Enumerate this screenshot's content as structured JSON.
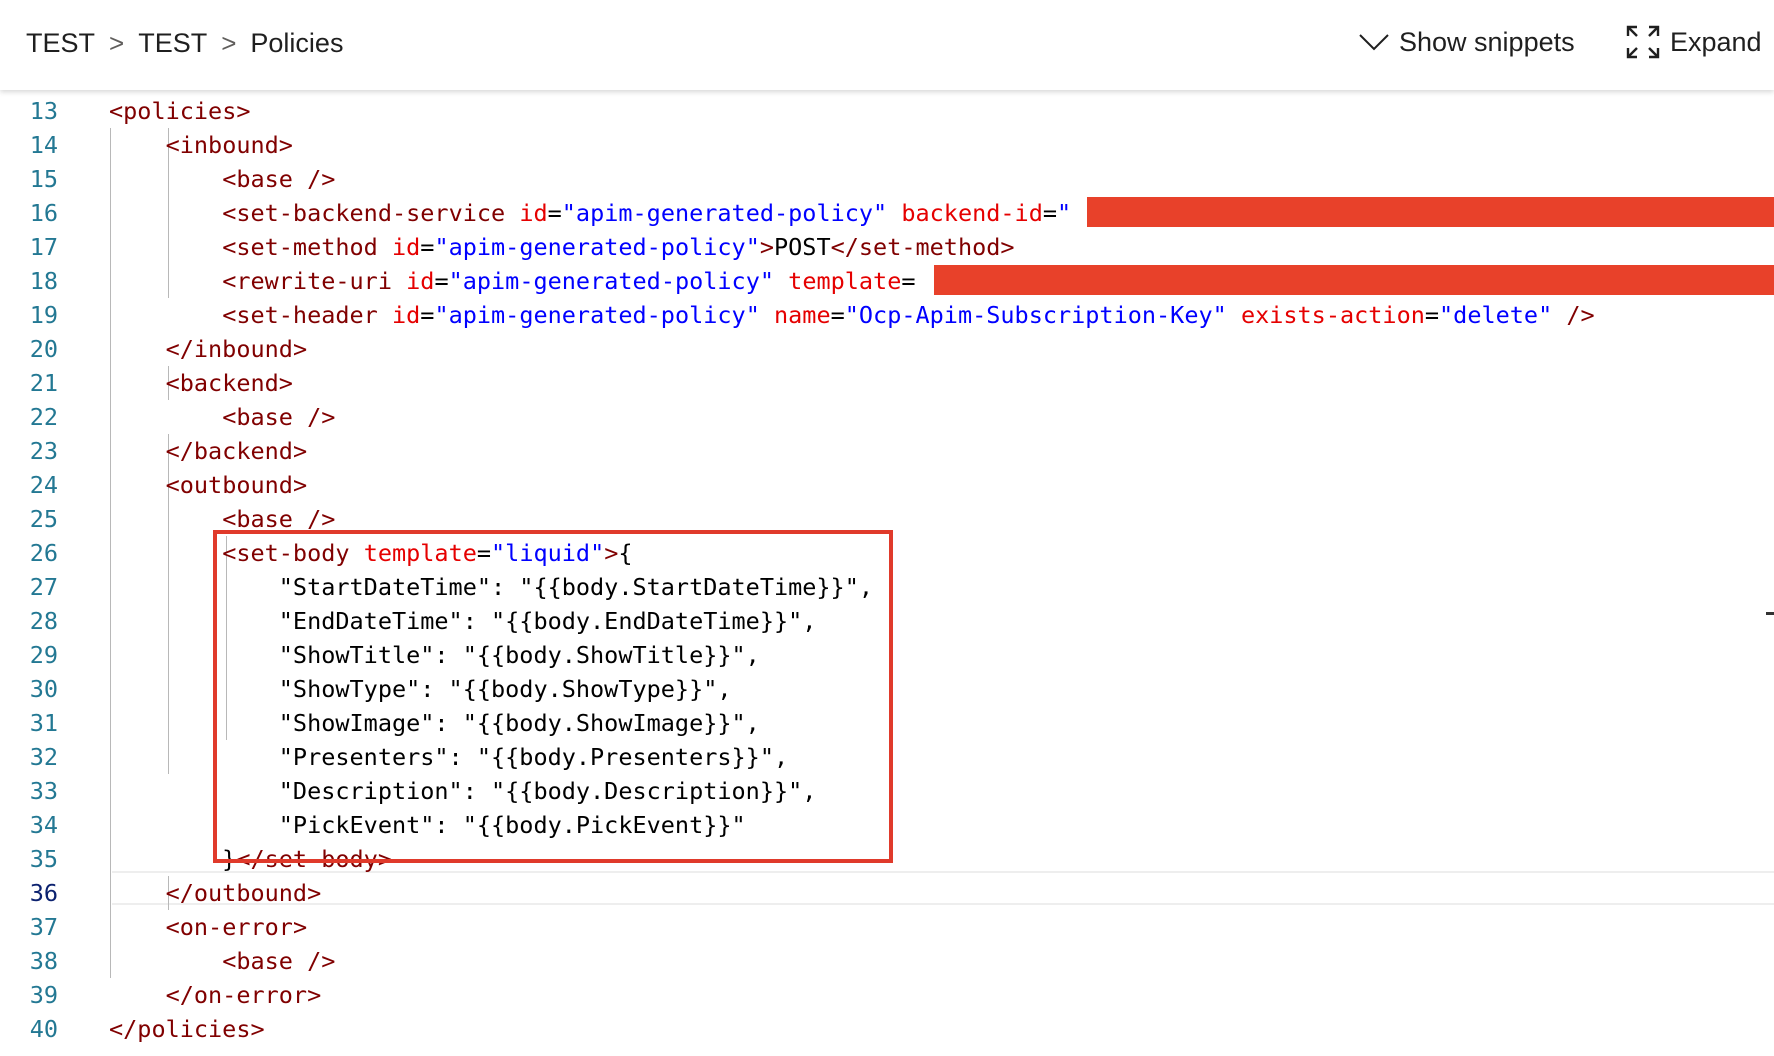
{
  "header": {
    "breadcrumb": [
      "TEST",
      "TEST",
      "Policies"
    ],
    "breadcrumb_separator": ">",
    "show_snippets_label": "Show snippets",
    "expand_label": "Expand"
  },
  "icons": {
    "show_snippets": "chevron-down-icon",
    "expand": "expand-arrows-icon"
  },
  "colors": {
    "tag": "#800000",
    "attribute_name": "#e50000",
    "attribute_value": "#0000ff",
    "line_number": "#237893",
    "redaction": "#e8412a",
    "highlight_box": "#e03a2b"
  },
  "editor": {
    "active_line": 36,
    "lines": [
      {
        "n": "13",
        "tokens": [
          [
            "dl",
            "<"
          ],
          [
            "tg",
            "policies"
          ],
          [
            "dl",
            ">"
          ]
        ]
      },
      {
        "n": "14",
        "tokens": [
          [
            "tx",
            "    "
          ],
          [
            "dl",
            "<"
          ],
          [
            "tg",
            "inbound"
          ],
          [
            "dl",
            ">"
          ]
        ]
      },
      {
        "n": "15",
        "tokens": [
          [
            "tx",
            "        "
          ],
          [
            "dl",
            "<"
          ],
          [
            "tg",
            "base"
          ],
          [
            "tx",
            " "
          ],
          [
            "dl",
            "/>"
          ]
        ]
      },
      {
        "n": "16",
        "tokens": [
          [
            "tx",
            "        "
          ],
          [
            "dl",
            "<"
          ],
          [
            "tg",
            "set-backend-service"
          ],
          [
            "tx",
            " "
          ],
          [
            "at",
            "id"
          ],
          [
            "eq",
            "="
          ],
          [
            "av",
            "\"apim-generated-policy\""
          ],
          [
            "tx",
            " "
          ],
          [
            "at",
            "backend-id"
          ],
          [
            "eq",
            "="
          ],
          [
            "av",
            "\""
          ]
        ]
      },
      {
        "n": "17",
        "tokens": [
          [
            "tx",
            "        "
          ],
          [
            "dl",
            "<"
          ],
          [
            "tg",
            "set-method"
          ],
          [
            "tx",
            " "
          ],
          [
            "at",
            "id"
          ],
          [
            "eq",
            "="
          ],
          [
            "av",
            "\"apim-generated-policy\""
          ],
          [
            "dl",
            ">"
          ],
          [
            "tx",
            "POST"
          ],
          [
            "dl",
            "</"
          ],
          [
            "tg",
            "set-method"
          ],
          [
            "dl",
            ">"
          ]
        ]
      },
      {
        "n": "18",
        "tokens": [
          [
            "tx",
            "        "
          ],
          [
            "dl",
            "<"
          ],
          [
            "tg",
            "rewrite-uri"
          ],
          [
            "tx",
            " "
          ],
          [
            "at",
            "id"
          ],
          [
            "eq",
            "="
          ],
          [
            "av",
            "\"apim-generated-policy\""
          ],
          [
            "tx",
            " "
          ],
          [
            "at",
            "template"
          ],
          [
            "eq",
            "="
          ]
        ]
      },
      {
        "n": "19",
        "tokens": [
          [
            "tx",
            "        "
          ],
          [
            "dl",
            "<"
          ],
          [
            "tg",
            "set-header"
          ],
          [
            "tx",
            " "
          ],
          [
            "at",
            "id"
          ],
          [
            "eq",
            "="
          ],
          [
            "av",
            "\"apim-generated-policy\""
          ],
          [
            "tx",
            " "
          ],
          [
            "at",
            "name"
          ],
          [
            "eq",
            "="
          ],
          [
            "av",
            "\"Ocp-Apim-Subscription-Key\""
          ],
          [
            "tx",
            " "
          ],
          [
            "at",
            "exists-action"
          ],
          [
            "eq",
            "="
          ],
          [
            "av",
            "\"delete\""
          ],
          [
            "tx",
            " "
          ],
          [
            "dl",
            "/>"
          ]
        ]
      },
      {
        "n": "20",
        "tokens": [
          [
            "tx",
            "    "
          ],
          [
            "dl",
            "</"
          ],
          [
            "tg",
            "inbound"
          ],
          [
            "dl",
            ">"
          ]
        ]
      },
      {
        "n": "21",
        "tokens": [
          [
            "tx",
            "    "
          ],
          [
            "dl",
            "<"
          ],
          [
            "tg",
            "backend"
          ],
          [
            "dl",
            ">"
          ]
        ]
      },
      {
        "n": "22",
        "tokens": [
          [
            "tx",
            "        "
          ],
          [
            "dl",
            "<"
          ],
          [
            "tg",
            "base"
          ],
          [
            "tx",
            " "
          ],
          [
            "dl",
            "/>"
          ]
        ]
      },
      {
        "n": "23",
        "tokens": [
          [
            "tx",
            "    "
          ],
          [
            "dl",
            "</"
          ],
          [
            "tg",
            "backend"
          ],
          [
            "dl",
            ">"
          ]
        ]
      },
      {
        "n": "24",
        "tokens": [
          [
            "tx",
            "    "
          ],
          [
            "dl",
            "<"
          ],
          [
            "tg",
            "outbound"
          ],
          [
            "dl",
            ">"
          ]
        ]
      },
      {
        "n": "25",
        "tokens": [
          [
            "tx",
            "        "
          ],
          [
            "dl",
            "<"
          ],
          [
            "tg",
            "base"
          ],
          [
            "tx",
            " "
          ],
          [
            "dl",
            "/>"
          ]
        ]
      },
      {
        "n": "26",
        "tokens": [
          [
            "tx",
            "        "
          ],
          [
            "dl",
            "<"
          ],
          [
            "tg",
            "set-body"
          ],
          [
            "tx",
            " "
          ],
          [
            "at",
            "template"
          ],
          [
            "eq",
            "="
          ],
          [
            "av",
            "\"liquid\""
          ],
          [
            "dl",
            ">"
          ],
          [
            "tx",
            "{"
          ]
        ]
      },
      {
        "n": "27",
        "tokens": [
          [
            "tx",
            "            \"StartDateTime\": \"{{body.StartDateTime}}\","
          ]
        ]
      },
      {
        "n": "28",
        "tokens": [
          [
            "tx",
            "            \"EndDateTime\": \"{{body.EndDateTime}}\","
          ]
        ]
      },
      {
        "n": "29",
        "tokens": [
          [
            "tx",
            "            \"ShowTitle\": \"{{body.ShowTitle}}\","
          ]
        ]
      },
      {
        "n": "30",
        "tokens": [
          [
            "tx",
            "            \"ShowType\": \"{{body.ShowType}}\","
          ]
        ]
      },
      {
        "n": "31",
        "tokens": [
          [
            "tx",
            "            \"ShowImage\": \"{{body.ShowImage}}\","
          ]
        ]
      },
      {
        "n": "32",
        "tokens": [
          [
            "tx",
            "            \"Presenters\": \"{{body.Presenters}}\","
          ]
        ]
      },
      {
        "n": "33",
        "tokens": [
          [
            "tx",
            "            \"Description\": \"{{body.Description}}\","
          ]
        ]
      },
      {
        "n": "34",
        "tokens": [
          [
            "tx",
            "            \"PickEvent\": \"{{body.PickEvent}}\""
          ]
        ]
      },
      {
        "n": "35",
        "tokens": [
          [
            "tx",
            "        }"
          ],
          [
            "dl",
            "</"
          ],
          [
            "tg",
            "set-body"
          ],
          [
            "dl",
            ">"
          ]
        ]
      },
      {
        "n": "36",
        "tokens": [
          [
            "tx",
            "    "
          ],
          [
            "dl",
            "</"
          ],
          [
            "tg",
            "outbound"
          ],
          [
            "dl",
            ">"
          ]
        ]
      },
      {
        "n": "37",
        "tokens": [
          [
            "tx",
            "    "
          ],
          [
            "dl",
            "<"
          ],
          [
            "tg",
            "on-error"
          ],
          [
            "dl",
            ">"
          ]
        ]
      },
      {
        "n": "38",
        "tokens": [
          [
            "tx",
            "        "
          ],
          [
            "dl",
            "<"
          ],
          [
            "tg",
            "base"
          ],
          [
            "tx",
            " "
          ],
          [
            "dl",
            "/>"
          ]
        ]
      },
      {
        "n": "39",
        "tokens": [
          [
            "tx",
            "    "
          ],
          [
            "dl",
            "</"
          ],
          [
            "tg",
            "on-error"
          ],
          [
            "dl",
            ">"
          ]
        ]
      },
      {
        "n": "40",
        "tokens": [
          [
            "dl",
            "</"
          ],
          [
            "tg",
            "policies"
          ],
          [
            "dl",
            ">"
          ]
        ]
      }
    ]
  }
}
